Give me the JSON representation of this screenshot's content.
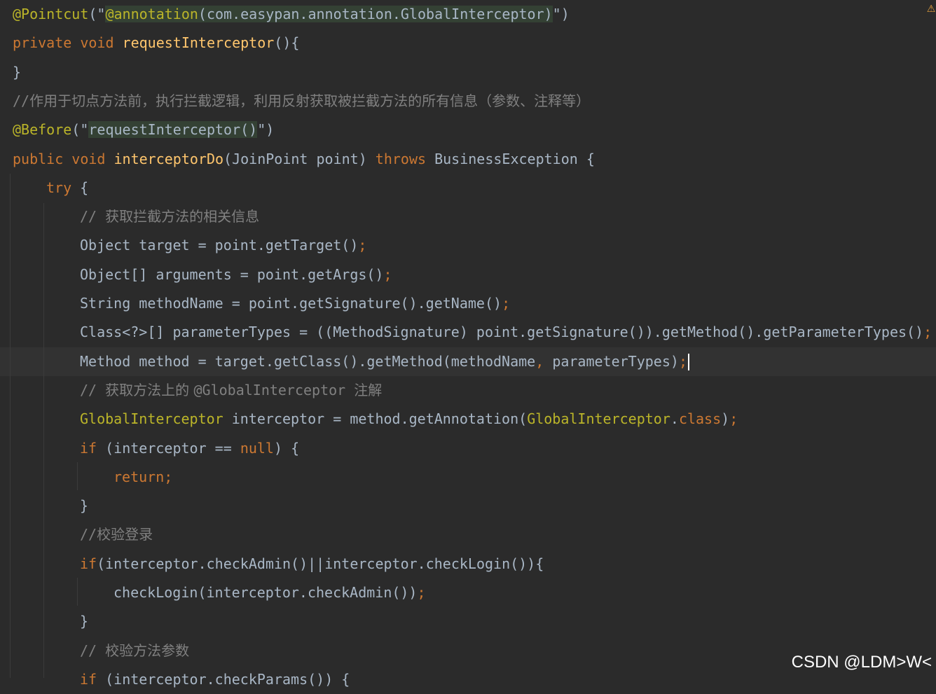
{
  "editor": {
    "lines": [
      {
        "tokens": [
          {
            "t": "@Pointcut",
            "c": "an"
          },
          {
            "t": "(\"",
            "c": ""
          },
          {
            "t": "@annotation",
            "c": "an sh"
          },
          {
            "t": "(com.easypan.annotation.GlobalInterceptor)",
            "c": "sh"
          },
          {
            "t": "\")",
            "c": ""
          }
        ]
      },
      {
        "tokens": [
          {
            "t": "private void ",
            "c": "k"
          },
          {
            "t": "requestInterceptor",
            "c": "m"
          },
          {
            "t": "(){",
            "c": ""
          }
        ]
      },
      {
        "tokens": [
          {
            "t": "}",
            "c": ""
          }
        ]
      },
      {
        "tokens": [
          {
            "t": "//",
            "c": "cmm"
          },
          {
            "t": "作用于切点方法前，执行拦截逻辑，利用反射获取被拦截方法的所有信息（参数、注释等）",
            "c": "cm"
          }
        ]
      },
      {
        "tokens": [
          {
            "t": "@Before",
            "c": "an"
          },
          {
            "t": "(\"",
            "c": ""
          },
          {
            "t": "requestInterceptor()",
            "c": "sh"
          },
          {
            "t": "\")",
            "c": ""
          }
        ]
      },
      {
        "tokens": [
          {
            "t": "public void ",
            "c": "k"
          },
          {
            "t": "interceptorDo",
            "c": "m"
          },
          {
            "t": "(JoinPoint point) ",
            "c": ""
          },
          {
            "t": "throws ",
            "c": "k"
          },
          {
            "t": "BusinessException {",
            "c": ""
          }
        ]
      },
      {
        "tokens": [
          {
            "t": "try ",
            "c": "k"
          },
          {
            "t": "{",
            "c": ""
          }
        ]
      },
      {
        "tokens": [
          {
            "t": "// ",
            "c": "cmm"
          },
          {
            "t": "获取拦截方法的相关信息",
            "c": "cm"
          }
        ]
      },
      {
        "tokens": [
          {
            "t": "Object target = point.getTarget()",
            "c": ""
          },
          {
            "t": ";",
            "c": "k"
          }
        ]
      },
      {
        "tokens": [
          {
            "t": "Object[] arguments = point.getArgs()",
            "c": ""
          },
          {
            "t": ";",
            "c": "k"
          }
        ]
      },
      {
        "tokens": [
          {
            "t": "String methodName = point.getSignature().getName()",
            "c": ""
          },
          {
            "t": ";",
            "c": "k"
          }
        ]
      },
      {
        "tokens": [
          {
            "t": "Class<?>[] parameterTypes = ((MethodSignature) point.getSignature()).getMethod().getParameterTypes()",
            "c": ""
          },
          {
            "t": ";",
            "c": "k"
          }
        ]
      },
      {
        "tokens": [
          {
            "t": "Method method = target.getClass().getMethod(methodName",
            "c": ""
          },
          {
            "t": ", ",
            "c": "k"
          },
          {
            "t": "parameterTypes)",
            "c": ""
          },
          {
            "t": ";",
            "c": "k"
          }
        ]
      },
      {
        "tokens": [
          {
            "t": "// ",
            "c": "cmm"
          },
          {
            "t": "获取方法上的 ",
            "c": "cm"
          },
          {
            "t": "@GlobalInterceptor ",
            "c": "cmm"
          },
          {
            "t": "注解",
            "c": "cm"
          }
        ]
      },
      {
        "tokens": [
          {
            "t": "GlobalInterceptor",
            "c": "an"
          },
          {
            "t": " interceptor = method.getAnnotation(",
            "c": ""
          },
          {
            "t": "GlobalInterceptor",
            "c": "an"
          },
          {
            "t": ".",
            "c": ""
          },
          {
            "t": "class",
            "c": "k"
          },
          {
            "t": ")",
            "c": ""
          },
          {
            "t": ";",
            "c": "k"
          }
        ]
      },
      {
        "tokens": [
          {
            "t": "if ",
            "c": "k"
          },
          {
            "t": "(interceptor ",
            "c": ""
          },
          {
            "t": "==",
            "c": ""
          },
          {
            "t": " ",
            "c": ""
          },
          {
            "t": "null",
            "c": "k"
          },
          {
            "t": ") {",
            "c": ""
          }
        ]
      },
      {
        "tokens": [
          {
            "t": "return;",
            "c": "k"
          }
        ]
      },
      {
        "tokens": [
          {
            "t": "}",
            "c": ""
          }
        ]
      },
      {
        "tokens": [
          {
            "t": "//",
            "c": "cmm"
          },
          {
            "t": "校验登录",
            "c": "cm"
          }
        ]
      },
      {
        "tokens": [
          {
            "t": "if",
            "c": "k"
          },
          {
            "t": "(interceptor.checkAdmin()||interceptor.checkLogin()){",
            "c": ""
          }
        ]
      },
      {
        "tokens": [
          {
            "t": "checkLogin(interceptor.checkAdmin())",
            "c": ""
          },
          {
            "t": ";",
            "c": "k"
          }
        ]
      },
      {
        "tokens": [
          {
            "t": "}",
            "c": ""
          }
        ]
      },
      {
        "tokens": [
          {
            "t": "// ",
            "c": "cmm"
          },
          {
            "t": "校验方法参数",
            "c": "cm"
          }
        ]
      },
      {
        "tokens": [
          {
            "t": "if ",
            "c": "k"
          },
          {
            "t": "(interceptor.checkParams()) {",
            "c": ""
          }
        ]
      }
    ],
    "caret_line": 12,
    "current_line": 12
  },
  "colors": {
    "background": "#2b2b2b",
    "keyword": "#cc7832",
    "annotation": "#bbb529",
    "method": "#ffc66d",
    "comment": "#808080",
    "default": "#a9b7c6",
    "injected_language_bg": "#344134",
    "warning": "#e8a33d"
  },
  "gutter": {
    "warning_icon": "warning-icon"
  },
  "watermark": {
    "text": "CSDN @LDM>W<"
  }
}
